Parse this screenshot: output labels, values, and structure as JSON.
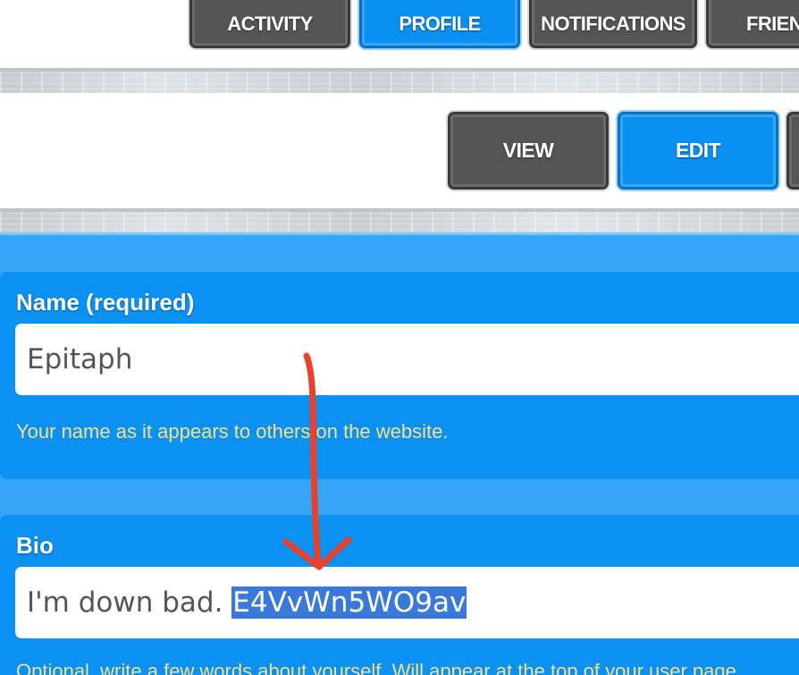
{
  "top_nav": {
    "tabs": [
      {
        "label": "ACTIVITY",
        "active": false
      },
      {
        "label": "PROFILE",
        "active": true
      },
      {
        "label": "NOTIFICATIONS",
        "active": false
      },
      {
        "label": "FRIEN",
        "active": false
      }
    ]
  },
  "sub_nav": {
    "tabs": [
      {
        "label": "VIEW",
        "active": false
      },
      {
        "label": "EDIT",
        "active": true
      },
      {
        "label": "",
        "active": false
      }
    ]
  },
  "form": {
    "name_field": {
      "label": "Name (required)",
      "value": "Epitaph",
      "help": "Your name as it appears to others on the website."
    },
    "bio_field": {
      "label": "Bio",
      "value_plain": "I'm down bad. ",
      "value_selected": "E4VvWn5WO9av",
      "help": "Optional, write a few words about yourself. Will appear at the top of your user page"
    }
  },
  "annotation": {
    "type": "red-arrow-icon",
    "color": "#e8412c"
  },
  "colors": {
    "active_tab": "#0a90f0",
    "inactive_tab": "#555555",
    "form_background": "#0a91f2",
    "help_text": "#f5e08a",
    "selection": "#3a79d9"
  }
}
